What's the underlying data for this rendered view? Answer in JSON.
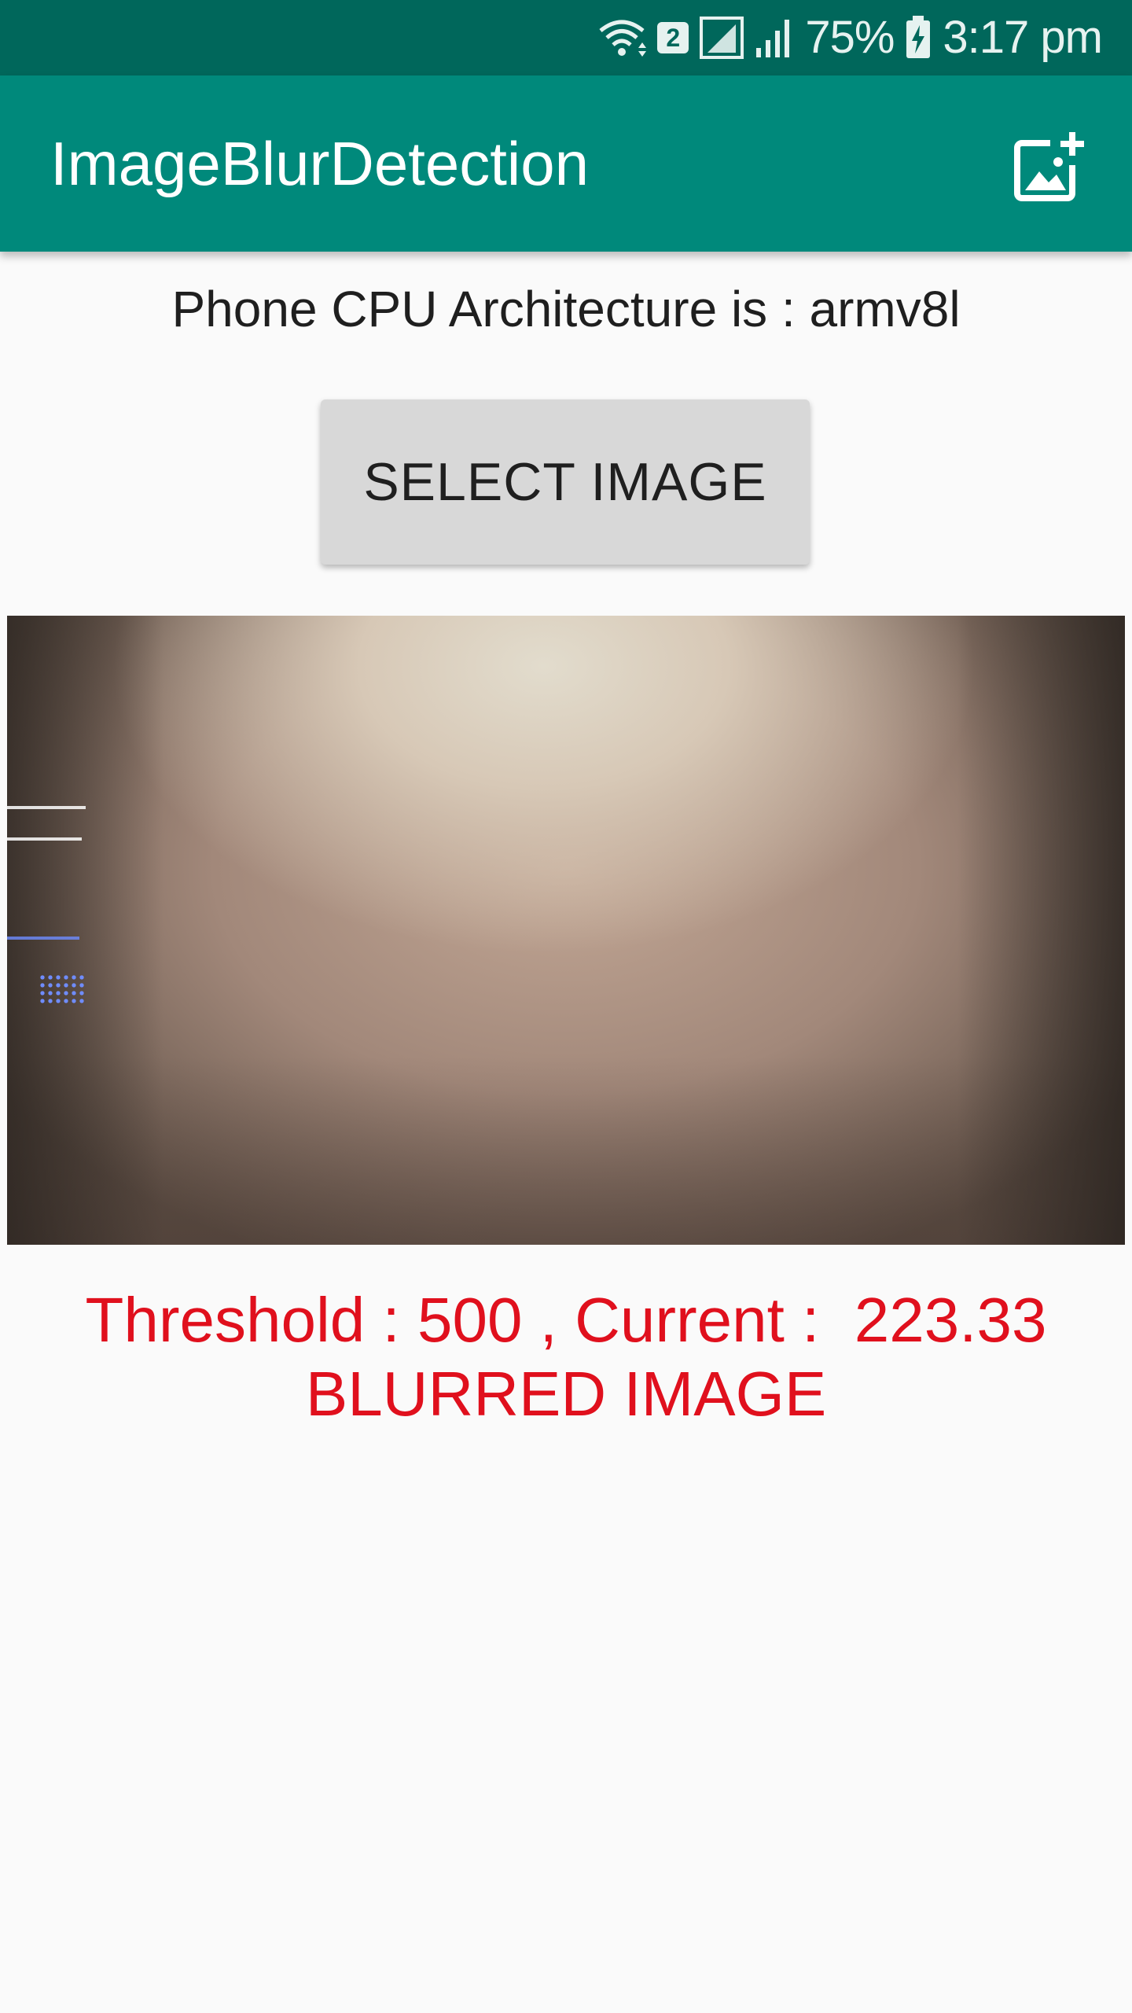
{
  "status_bar": {
    "sim_slot": "2",
    "battery": "75%",
    "time": "3:17 pm",
    "icons": [
      "wifi-icon",
      "sim-icon",
      "signal-icon",
      "signal-icon",
      "battery-charging-icon"
    ]
  },
  "app_bar": {
    "title": "ImageBlurDetection",
    "action_icon": "add-photo-icon",
    "color": "#00897b"
  },
  "cpu_info": "Phone CPU Architecture is : armv8l",
  "select_button_label": "SELECT IMAGE",
  "result": {
    "line1": "Threshold : 500 , Current :  223.33",
    "line2": "BLURRED IMAGE",
    "color": "#e0101d"
  }
}
